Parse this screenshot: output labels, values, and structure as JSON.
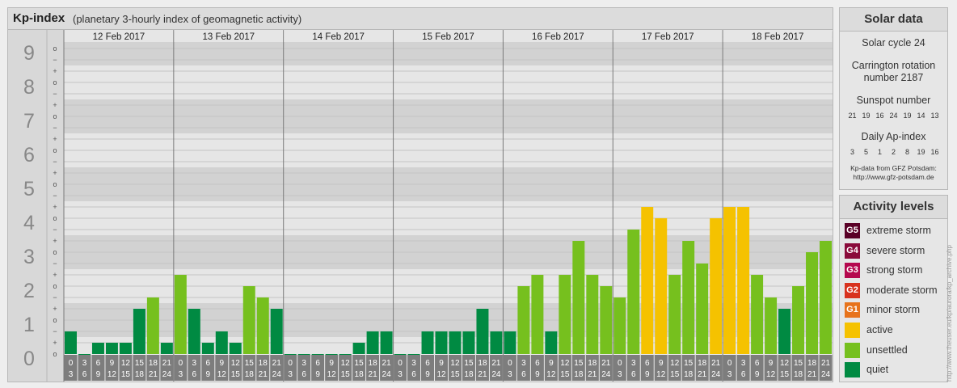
{
  "title": {
    "main": "Kp-index",
    "subtitle": "(planetary 3-hourly index of geomagnetic activity)"
  },
  "chart_data": {
    "type": "bar",
    "title": "Kp-index",
    "subtitle": "(planetary 3-hourly index of geomagnetic activity)",
    "ylim": [
      0,
      9.5
    ],
    "y_ticks": [
      "0",
      "1",
      "2",
      "3",
      "4",
      "5",
      "6",
      "7",
      "8",
      "9"
    ],
    "minor_marks": [
      "o",
      "+",
      "−"
    ],
    "days": [
      "12 Feb 2017",
      "13 Feb 2017",
      "14 Feb 2017",
      "15 Feb 2017",
      "16 Feb 2017",
      "17 Feb 2017",
      "18 Feb 2017"
    ],
    "interval_top": [
      "0",
      "3",
      "6",
      "9",
      "12",
      "15",
      "18",
      "21"
    ],
    "interval_bottom": [
      "3",
      "6",
      "9",
      "12",
      "15",
      "18",
      "21",
      "24"
    ],
    "values": [
      [
        0.667,
        0,
        0.333,
        0.333,
        0.333,
        1.333,
        1.667,
        0.333
      ],
      [
        2.333,
        1.333,
        0.333,
        0.667,
        0.333,
        2,
        1.667,
        1.333
      ],
      [
        0,
        0,
        0,
        0,
        0,
        0.333,
        0.667,
        0.667
      ],
      [
        0,
        0,
        0.667,
        0.667,
        0.667,
        0.667,
        1.333,
        0.667
      ],
      [
        0.667,
        2,
        2.333,
        0.667,
        2.333,
        3.333,
        2.333,
        2
      ],
      [
        1.667,
        3.667,
        4.333,
        4,
        2.333,
        3.333,
        2.667,
        4
      ],
      [
        4.333,
        4.333,
        2.333,
        1.667,
        1.333,
        2,
        3,
        3.333
      ]
    ],
    "level_colors": {
      "quiet": "#008a42",
      "unsettled": "#76c01e",
      "active": "#f5c200"
    }
  },
  "solar": {
    "heading": "Solar data",
    "cycle": "Solar cycle 24",
    "carrington_1": "Carrington rotation",
    "carrington_2": "number 2187",
    "sunspot_heading": "Sunspot number",
    "sunspot_values": [
      "21",
      "19",
      "16",
      "24",
      "19",
      "14",
      "13"
    ],
    "ap_heading": "Daily Ap-index",
    "ap_values": [
      "3",
      "5",
      "1",
      "2",
      "8",
      "19",
      "16"
    ],
    "credit_1": "Kp-data from GFZ Potsdam:",
    "credit_2": "http://www.gfz-potsdam.de"
  },
  "activity": {
    "heading": "Activity levels",
    "levels": [
      {
        "code": "G5",
        "label": "extreme storm",
        "color": "#5a0026"
      },
      {
        "code": "G4",
        "label": "severe storm",
        "color": "#8a0a3a"
      },
      {
        "code": "G3",
        "label": "strong storm",
        "color": "#b5084e"
      },
      {
        "code": "G2",
        "label": "moderate storm",
        "color": "#d8321e"
      },
      {
        "code": "G1",
        "label": "minor storm",
        "color": "#e7731b"
      },
      {
        "code": "",
        "label": "active",
        "color": "#f5c200"
      },
      {
        "code": "",
        "label": "unsettled",
        "color": "#76c01e"
      },
      {
        "code": "",
        "label": "quiet",
        "color": "#008a42"
      }
    ]
  },
  "watermark": "http://www.theuser.eu/kp/aurora/kp_archive.php"
}
